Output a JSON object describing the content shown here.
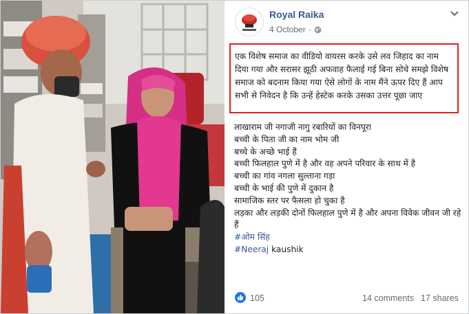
{
  "post": {
    "page_name": "Royal Raika",
    "date": "4 October",
    "privacy_icon": "globe-icon",
    "menu_icon": "chevron-down-icon",
    "highlighted_text": "एक विशेष समाज का वीडियो वायरस करके उसे लव जिहाद का नाम दिया गया और सरासर झूठी अफवाह फैलाई गई बिना सोचे समझे विशेष समाज को बदनाम किया गया ऐसे लोगों के नाम मैंने ऊपर दिए हैं आप सभी से निवेदन है कि उन्हें हेस्टेक करके उसका उत्तर पूछा जाए",
    "lines": [
      "लाखाराम जी नगाजी नागु रबारियों का विनपूरा",
      "बच्ची के पिता जी का नाम भोम जी",
      "बच्चे के अच्छे भाई हैं",
      "बच्ची फिलहाल पुणे में है और वह अपने परिवार के साथ में है",
      "बच्ची का गांव नगला सुल्ताना गड़ा",
      "बच्ची के भाई की पुणे में दुकान है",
      "सामाजिक स्तर पर फैसला हो चुका है",
      "लड़का और लड़की दोनों फिलहाल पुणे में है और अपना विवेक जीवन जी रहे हैं"
    ],
    "hashtag_1": "#ओम सिंह",
    "hashtag_2": "#Neeraj",
    "hashtag_2_suffix": " kaushik",
    "likes": "105",
    "comments": "14 comments",
    "shares": "17 shares",
    "colors": {
      "link": "#385898",
      "highlight_border": "#e0231d",
      "like_blue": "#1877f2"
    }
  },
  "photo": {
    "description_icon": "video-still-image"
  }
}
